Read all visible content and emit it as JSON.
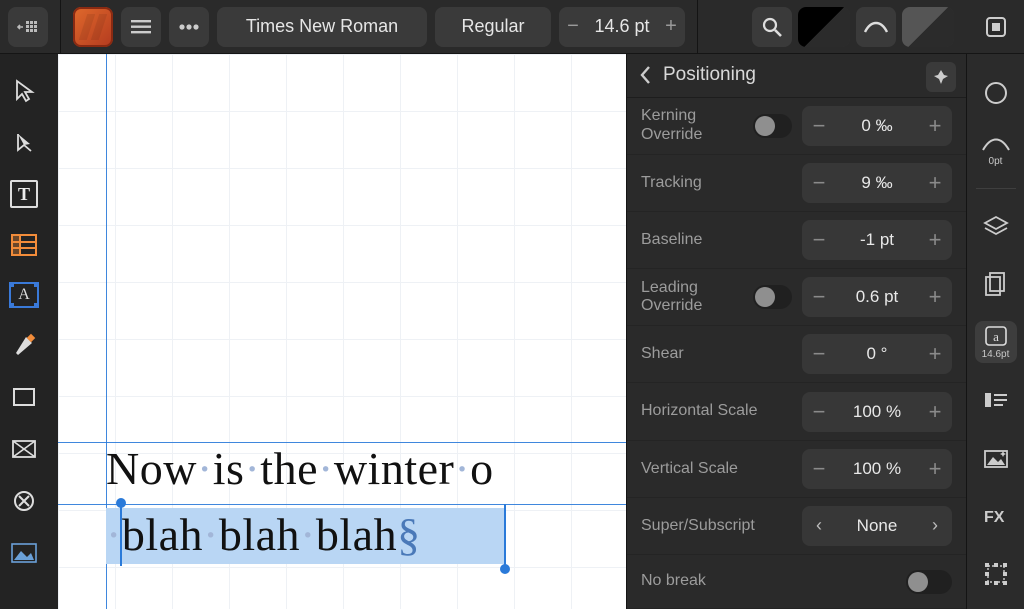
{
  "toolbar": {
    "font_family": "Times New Roman",
    "font_style": "Regular",
    "font_size": "14.6 pt"
  },
  "panel": {
    "title": "Positioning",
    "rows": {
      "kerning": {
        "label": "Kerning Override",
        "value": "0 ‰"
      },
      "tracking": {
        "label": "Tracking",
        "value": "9 ‰"
      },
      "baseline": {
        "label": "Baseline",
        "value": "-1 pt"
      },
      "leading": {
        "label": "Leading Override",
        "value": "0.6 pt"
      },
      "shear": {
        "label": "Shear",
        "value": "0 °"
      },
      "hscale": {
        "label": "Horizontal Scale",
        "value": "100 %"
      },
      "vscale": {
        "label": "Vertical Scale",
        "value": "100 %"
      },
      "script": {
        "label": "Super/Subscript",
        "value": "None"
      },
      "nobreak": {
        "label": "No break"
      }
    }
  },
  "studio": {
    "opt_label": "0pt",
    "char_size": "14.6pt"
  },
  "canvas": {
    "line1": {
      "w0": "Now",
      "w1": "is",
      "w2": "the",
      "w3": "winter",
      "w4": "o"
    },
    "line2": {
      "w0": "blah",
      "w1": "blah",
      "w2": "blah",
      "end": "§"
    }
  }
}
